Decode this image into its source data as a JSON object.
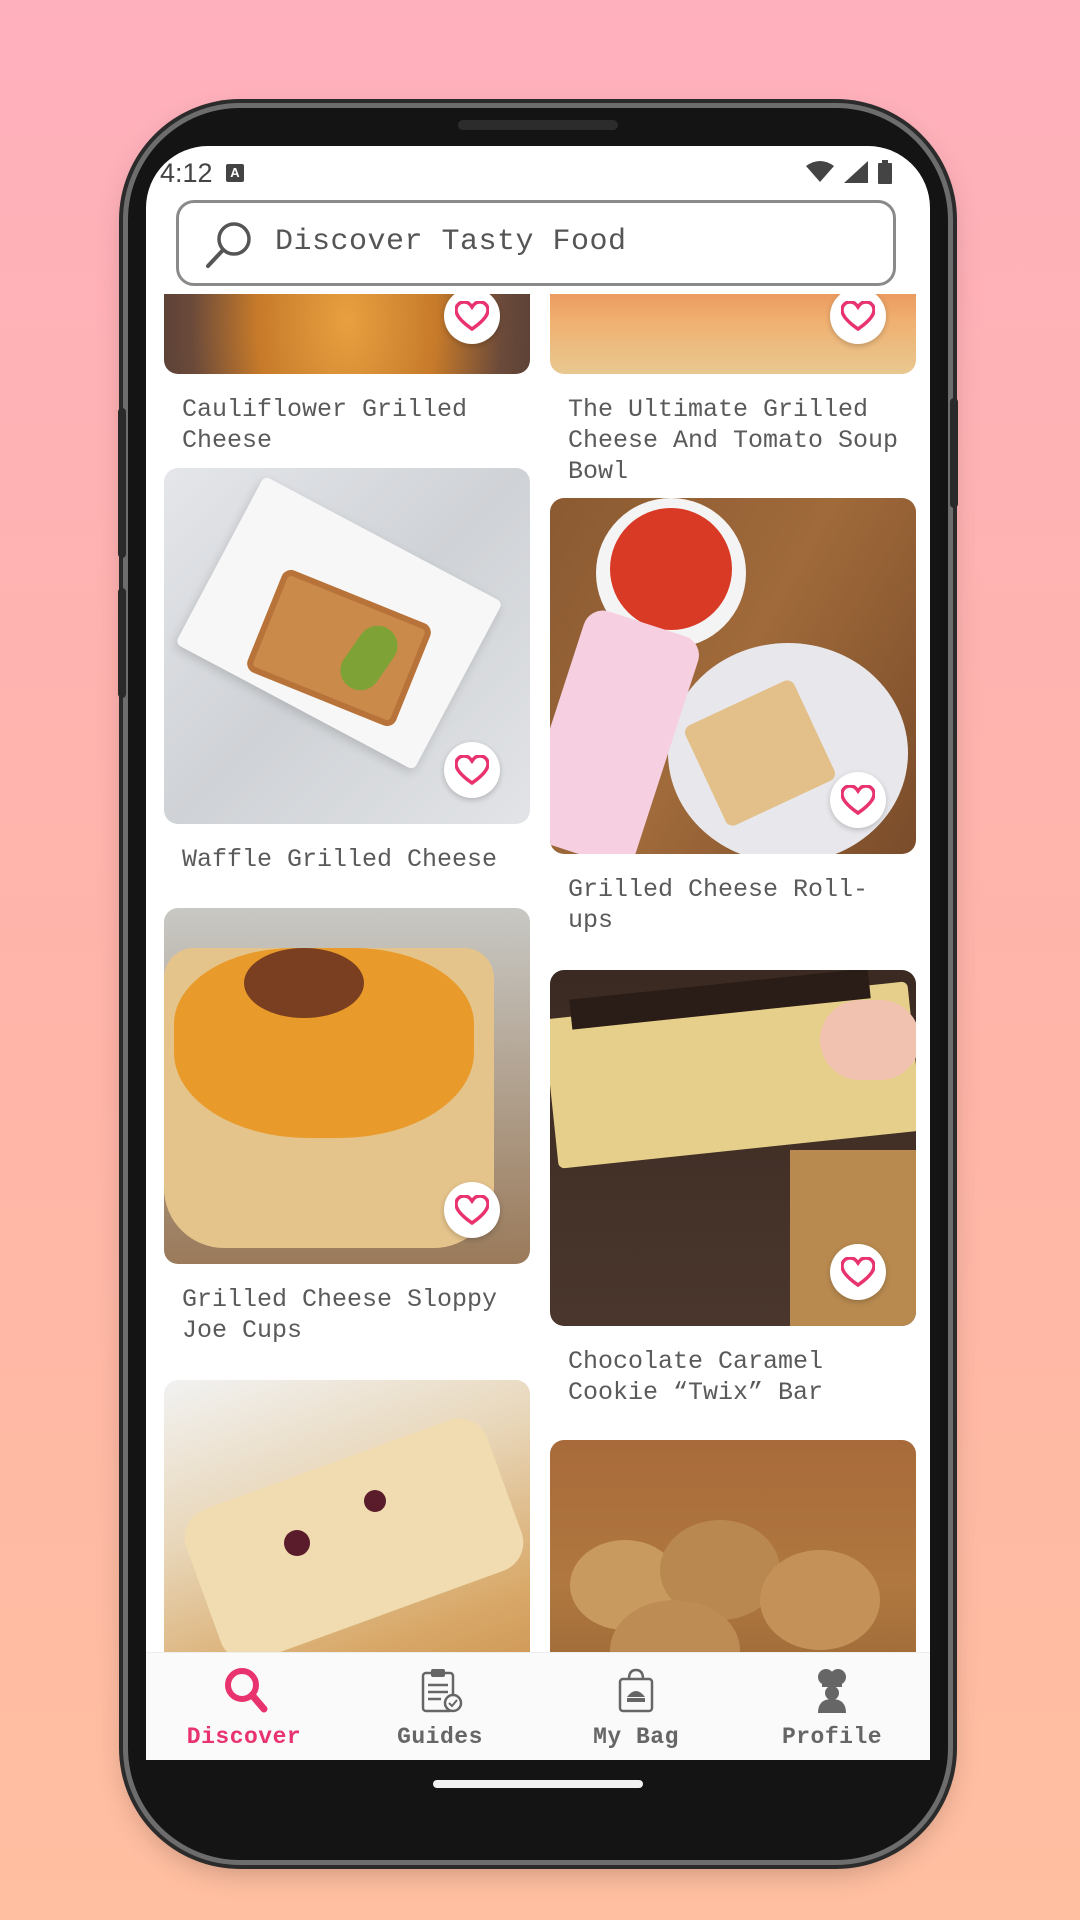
{
  "status_bar": {
    "time": "4:12",
    "keyboard_badge": "A"
  },
  "search": {
    "placeholder": "Discover Tasty Food"
  },
  "recipes": [
    {
      "title": "Cauliflower Grilled Cheese"
    },
    {
      "title": "The Ultimate Grilled Cheese And Tomato Soup Bowl"
    },
    {
      "title": "Waffle Grilled Cheese"
    },
    {
      "title": "Grilled Cheese Roll-ups"
    },
    {
      "title": "Grilled Cheese Sloppy Joe Cups"
    },
    {
      "title": "Chocolate Caramel Cookie “Twix” Bar"
    },
    {
      "title": ""
    },
    {
      "title": ""
    }
  ],
  "bottom_nav": {
    "items": [
      {
        "label": "Discover",
        "icon": "search-icon",
        "active": true
      },
      {
        "label": "Guides",
        "icon": "clipboard-icon",
        "active": false
      },
      {
        "label": "My Bag",
        "icon": "shopping-bag-icon",
        "active": false
      },
      {
        "label": "Profile",
        "icon": "chef-icon",
        "active": false
      }
    ]
  },
  "colors": {
    "accent": "#e8336e",
    "background_top": "#ffb0bd",
    "background_bottom": "#ffbfa0"
  }
}
